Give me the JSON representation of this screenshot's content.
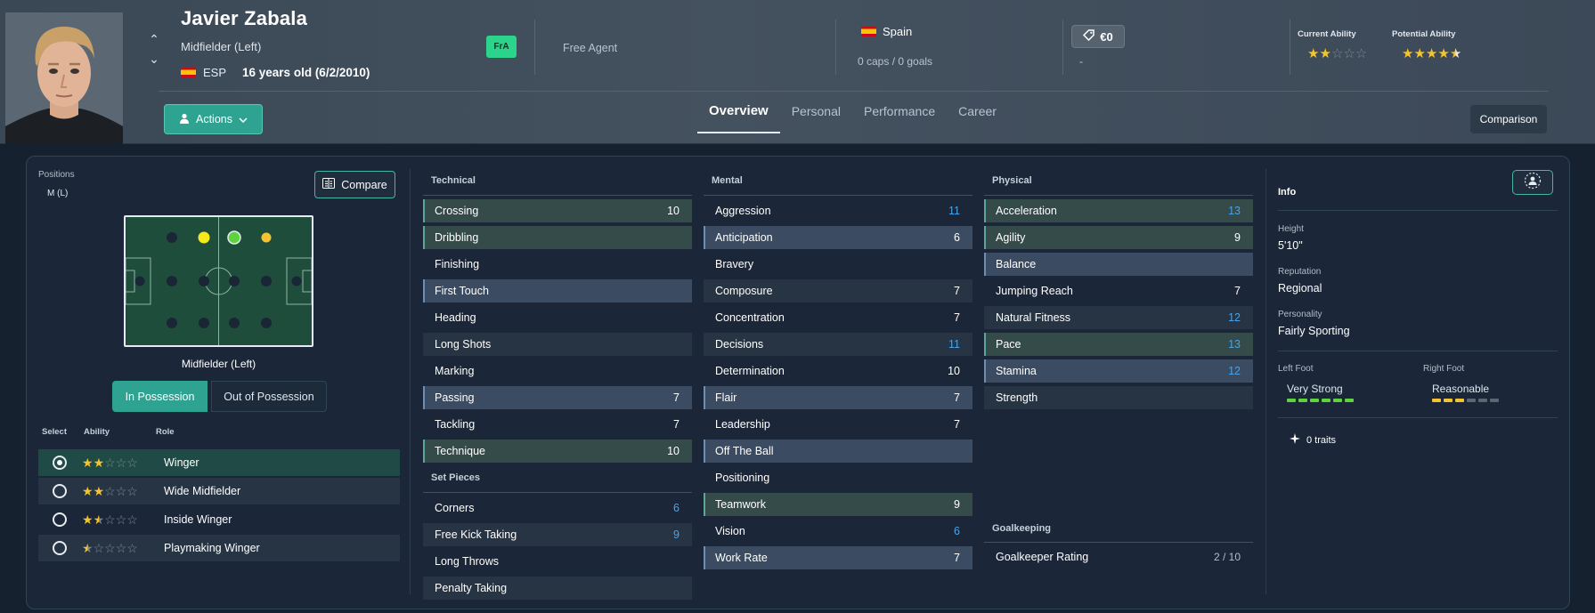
{
  "player": {
    "name": "Javier Zabala",
    "position": "Midfielder (Left)",
    "nationality_code": "ESP",
    "age": "16 years old (6/2/2010)",
    "badge": "FrA",
    "contract": "Free Agent",
    "nation": "Spain",
    "caps": "0 caps / 0 goals",
    "value": "€0",
    "value_sub": "-",
    "current_ability_label": "Current Ability",
    "potential_ability_label": "Potential Ability",
    "current_ability_stars": 2,
    "potential_ability_stars": 4.5
  },
  "header": {
    "actions_label": "Actions",
    "tabs": [
      "Overview",
      "Personal",
      "Performance",
      "Career"
    ],
    "active_tab": "Overview",
    "comparison_label": "Comparison"
  },
  "positions": {
    "label": "Positions",
    "value": "M (L)",
    "compare_label": "Compare",
    "pitch_caption": "Midfielder (Left)",
    "in_possession": "In Possession",
    "out_possession": "Out of Possession"
  },
  "roles": {
    "headers": {
      "select": "Select",
      "ability": "Ability",
      "role": "Role"
    },
    "items": [
      {
        "name": "Winger",
        "stars": 2,
        "selected": true
      },
      {
        "name": "Wide Midfielder",
        "stars": 2,
        "selected": false
      },
      {
        "name": "Inside Winger",
        "stars": 1.5,
        "selected": false
      },
      {
        "name": "Playmaking Winger",
        "stars": 0.5,
        "selected": false
      }
    ]
  },
  "technical": {
    "title": "Technical",
    "rows": [
      {
        "name": "Crossing",
        "value": "10",
        "style": "hl-green",
        "color": "white"
      },
      {
        "name": "Dribbling",
        "value": "",
        "style": "hl-green",
        "color": "white"
      },
      {
        "name": "Finishing",
        "value": "",
        "style": "",
        "color": "white"
      },
      {
        "name": "First Touch",
        "value": "",
        "style": "hl-blue",
        "color": "white"
      },
      {
        "name": "Heading",
        "value": "",
        "style": "",
        "color": "white"
      },
      {
        "name": "Long Shots",
        "value": "",
        "style": "bg-alt",
        "color": "white"
      },
      {
        "name": "Marking",
        "value": "",
        "style": "",
        "color": "white"
      },
      {
        "name": "Passing",
        "value": "7",
        "style": "hl-blue",
        "color": "white"
      },
      {
        "name": "Tackling",
        "value": "7",
        "style": "",
        "color": "white"
      },
      {
        "name": "Technique",
        "value": "10",
        "style": "hl-green",
        "color": "white"
      }
    ]
  },
  "set_pieces": {
    "title": "Set Pieces",
    "rows": [
      {
        "name": "Corners",
        "value": "6",
        "style": "",
        "color": "blue"
      },
      {
        "name": "Free Kick Taking",
        "value": "9",
        "style": "bg-alt",
        "color": "blue"
      },
      {
        "name": "Long Throws",
        "value": "",
        "style": "",
        "color": "white"
      },
      {
        "name": "Penalty Taking",
        "value": "",
        "style": "bg-alt",
        "color": "white"
      }
    ]
  },
  "mental": {
    "title": "Mental",
    "rows": [
      {
        "name": "Aggression",
        "value": "11",
        "style": "",
        "color": "blue"
      },
      {
        "name": "Anticipation",
        "value": "6",
        "style": "hl-blue",
        "color": "white"
      },
      {
        "name": "Bravery",
        "value": "",
        "style": "",
        "color": "white"
      },
      {
        "name": "Composure",
        "value": "7",
        "style": "bg-alt",
        "color": "white"
      },
      {
        "name": "Concentration",
        "value": "7",
        "style": "",
        "color": "white"
      },
      {
        "name": "Decisions",
        "value": "11",
        "style": "bg-alt",
        "color": "blue"
      },
      {
        "name": "Determination",
        "value": "10",
        "style": "",
        "color": "white"
      },
      {
        "name": "Flair",
        "value": "7",
        "style": "hl-blue",
        "color": "white"
      },
      {
        "name": "Leadership",
        "value": "7",
        "style": "",
        "color": "white"
      },
      {
        "name": "Off The Ball",
        "value": "",
        "style": "hl-blue",
        "color": "white"
      },
      {
        "name": "Positioning",
        "value": "",
        "style": "",
        "color": "white"
      },
      {
        "name": "Teamwork",
        "value": "9",
        "style": "hl-green",
        "color": "white"
      },
      {
        "name": "Vision",
        "value": "6",
        "style": "",
        "color": "blue"
      },
      {
        "name": "Work Rate",
        "value": "7",
        "style": "hl-blue",
        "color": "white"
      }
    ]
  },
  "physical": {
    "title": "Physical",
    "rows": [
      {
        "name": "Acceleration",
        "value": "13",
        "style": "hl-green",
        "color": "blue"
      },
      {
        "name": "Agility",
        "value": "9",
        "style": "hl-green",
        "color": "white"
      },
      {
        "name": "Balance",
        "value": "",
        "style": "hl-blue",
        "color": "white"
      },
      {
        "name": "Jumping Reach",
        "value": "7",
        "style": "",
        "color": "white"
      },
      {
        "name": "Natural Fitness",
        "value": "12",
        "style": "bg-alt",
        "color": "blue"
      },
      {
        "name": "Pace",
        "value": "13",
        "style": "hl-green",
        "color": "blue"
      },
      {
        "name": "Stamina",
        "value": "12",
        "style": "hl-blue",
        "color": "blue"
      },
      {
        "name": "Strength",
        "value": "",
        "style": "bg-alt",
        "color": "white"
      }
    ]
  },
  "goalkeeping": {
    "title": "Goalkeeping",
    "rating_label": "Goalkeeper Rating",
    "rating_value": "2 / 10"
  },
  "info": {
    "title": "Info",
    "height_label": "Height",
    "height": "5'10\"",
    "reputation_label": "Reputation",
    "reputation": "Regional",
    "personality_label": "Personality",
    "personality": "Fairly Sporting",
    "left_foot_label": "Left Foot",
    "left_foot": "Very Strong",
    "left_foot_level": 6,
    "right_foot_label": "Right Foot",
    "right_foot": "Reasonable",
    "right_foot_level": 3,
    "traits": "0 traits"
  },
  "colors": {
    "accent": "#2fa391",
    "star": "#f4c430",
    "blue_value": "#4aa3e8",
    "foot_green": "#5ed33f",
    "foot_yellow": "#f4c430"
  }
}
